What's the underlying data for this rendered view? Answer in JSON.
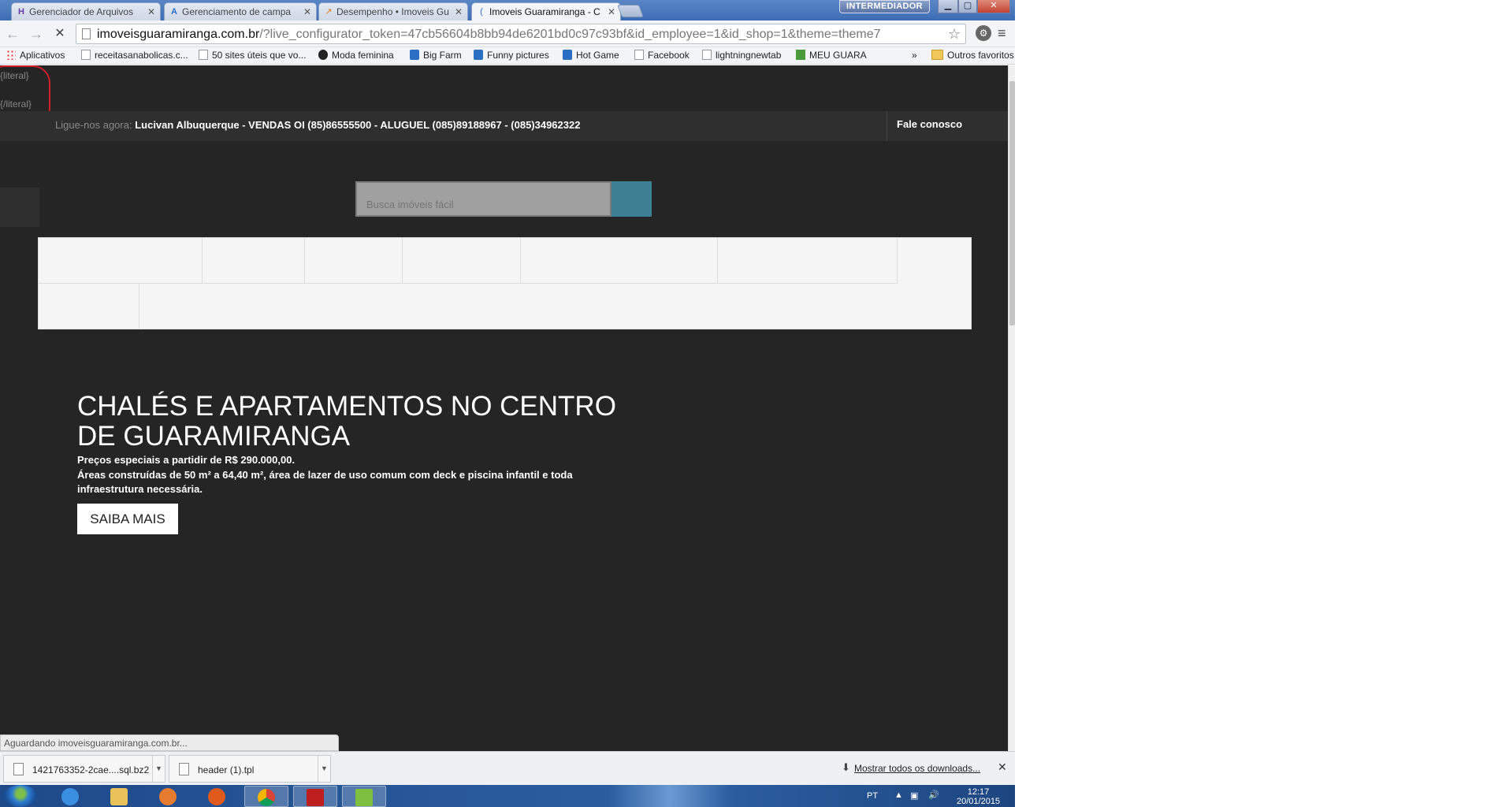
{
  "tabs": [
    {
      "title": "Gerenciador de Arquivos",
      "icon": "cpanel-icon"
    },
    {
      "title": "Gerenciamento de campa",
      "icon": "adwords-icon"
    },
    {
      "title": "Desempenho • Imoveis Gu",
      "icon": "analytics-icon"
    },
    {
      "title": "Imoveis Guaramiranga - C",
      "icon": "loading-icon"
    }
  ],
  "profile_badge": "INTERMEDIADOR",
  "address": {
    "host": "imoveisguaramiranga.com.br",
    "path": "/?live_configurator_token=47cb56604b8bb94de6201bd0c97c93bf&id_employee=1&id_shop=1&theme=theme7"
  },
  "bookmarks": [
    {
      "label": "Aplicativos",
      "icon": "apps-icon"
    },
    {
      "label": "receitasanabolicas.c...",
      "icon": "page-icon"
    },
    {
      "label": "50 sites úteis que vo...",
      "icon": "page-icon"
    },
    {
      "label": "Moda feminina",
      "icon": "site-icon"
    },
    {
      "label": "Big Farm",
      "icon": "game-icon"
    },
    {
      "label": "Funny pictures",
      "icon": "site-icon"
    },
    {
      "label": "Hot Game",
      "icon": "game-icon"
    },
    {
      "label": "Facebook",
      "icon": "page-icon"
    },
    {
      "label": "lightningnewtab",
      "icon": "page-icon"
    },
    {
      "label": "MEU GUARA",
      "icon": "site-icon"
    }
  ],
  "bookmarks_more": "»",
  "bookmarks_other": "Outros favoritos",
  "page": {
    "literal_open": "{literal}",
    "literal_close": "{/literal}",
    "call_label": "Ligue-nos agora:",
    "call_numbers": "Lucivan Albuquerque - VENDAS OI (85)86555500 - ALUGUEL (085)89188967 - (085)34962322",
    "contact": "Fale conosco",
    "search_placeholder": "Busca imóveis fácil",
    "hero_title": "CHALÉS E APARTAMENTOS NO CENTRO DE GUARAMIRANGA",
    "hero_price": "Preços especiais a partidir de R$ 290.000,00.",
    "hero_desc": "Áreas construídas de 50 m² a 64,40  m², área de lazer de uso comum com deck e piscina infantil e toda infraestrutura necessária.",
    "hero_button": "SAIBA MAIS"
  },
  "status_text": "Aguardando imoveisguaramiranga.com.br...",
  "downloads": [
    {
      "name": "1421763352-2cae....sql.bz2"
    },
    {
      "name": "header (1).tpl"
    }
  ],
  "show_all_downloads": "Mostrar todos os downloads...",
  "taskbar": {
    "lang": "PT",
    "time": "12:17",
    "date": "20/01/2015"
  },
  "colors": {
    "page_bg": "#252525",
    "search_button": "#3f7f94",
    "annotation": "#d0202a"
  }
}
